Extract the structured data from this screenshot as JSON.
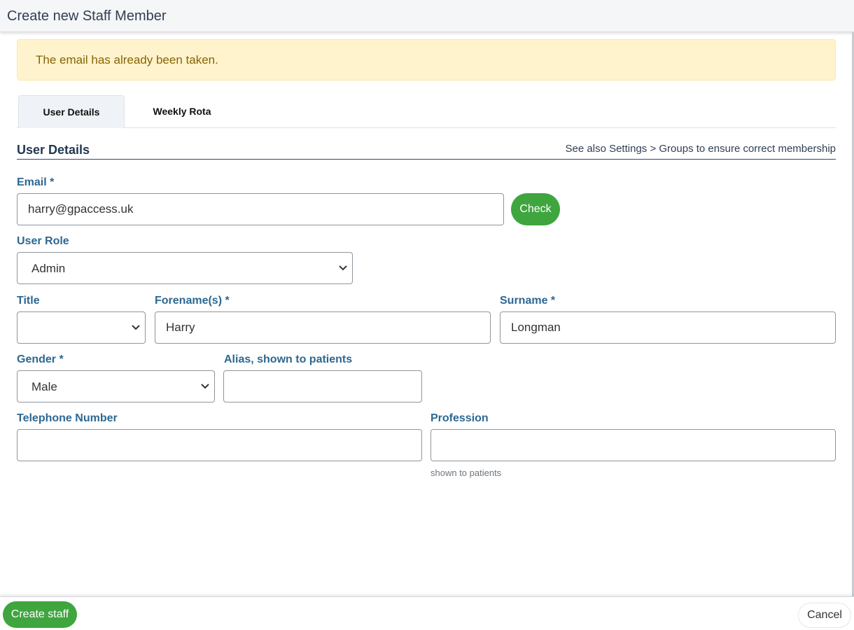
{
  "header": {
    "title": "Create new Staff Member"
  },
  "alert": {
    "message": "The email has already been taken."
  },
  "tabs": [
    {
      "label": "User Details",
      "active": true
    },
    {
      "label": "Weekly Rota",
      "active": false
    }
  ],
  "section": {
    "title": "User Details",
    "note": "See also Settings > Groups to ensure correct membership"
  },
  "form": {
    "email": {
      "label": "Email *",
      "value": "harry@gpaccess.uk",
      "check_label": "Check"
    },
    "user_role": {
      "label": "User Role",
      "selected": "Admin"
    },
    "title": {
      "label": "Title",
      "selected": ""
    },
    "forename": {
      "label": "Forename(s) *",
      "value": "Harry"
    },
    "surname": {
      "label": "Surname *",
      "value": "Longman"
    },
    "gender": {
      "label": "Gender *",
      "selected": "Male"
    },
    "alias": {
      "label": "Alias, shown to patients",
      "value": ""
    },
    "telephone": {
      "label": "Telephone Number",
      "value": ""
    },
    "profession": {
      "label": "Profession",
      "value": "",
      "hint": "shown to patients"
    }
  },
  "footer": {
    "create_label": "Create staff",
    "cancel_label": "Cancel"
  },
  "colors": {
    "primary_green": "#3fa53f",
    "label_blue": "#2d6891",
    "alert_bg": "#fff3cd",
    "alert_text": "#856404"
  },
  "icons": {
    "select_arrow": "chevron-down-icon"
  }
}
